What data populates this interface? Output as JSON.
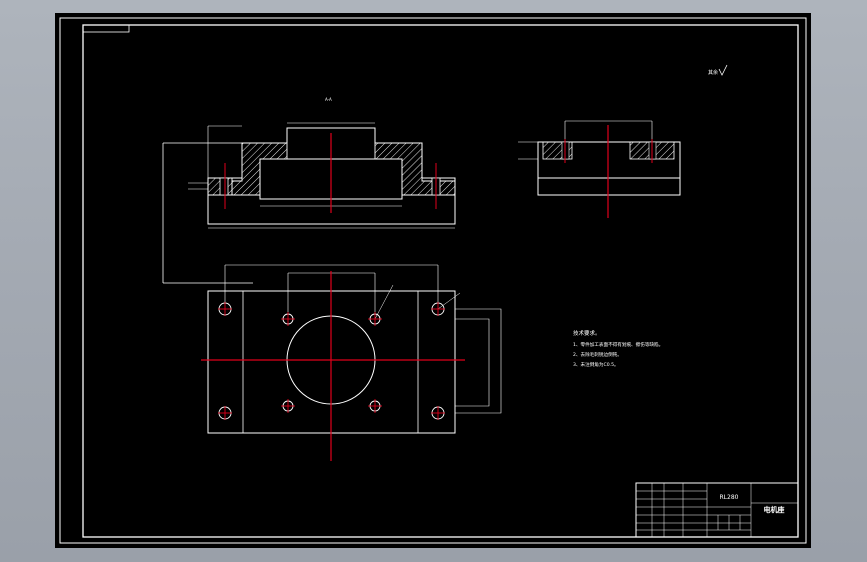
{
  "app": {
    "name": "CAD drawing viewer"
  },
  "colors": {
    "background": "#000000",
    "line": "#ffffff",
    "centerline": "#e0001b",
    "chrome": "#a3a9b2"
  },
  "title_block": {
    "part_code": "RL280",
    "part_name": "电机座"
  },
  "tech_notes": {
    "heading": "技术要求。",
    "lines": [
      "1、零件加工表面不得有划痕、擦伤等缺陷。",
      "2、去除毛刺锐边倒钝。",
      "3、未注倒角为C0.5。"
    ]
  },
  "annotations": {
    "roughness_symbol": "其余",
    "section_label": "A-A"
  }
}
